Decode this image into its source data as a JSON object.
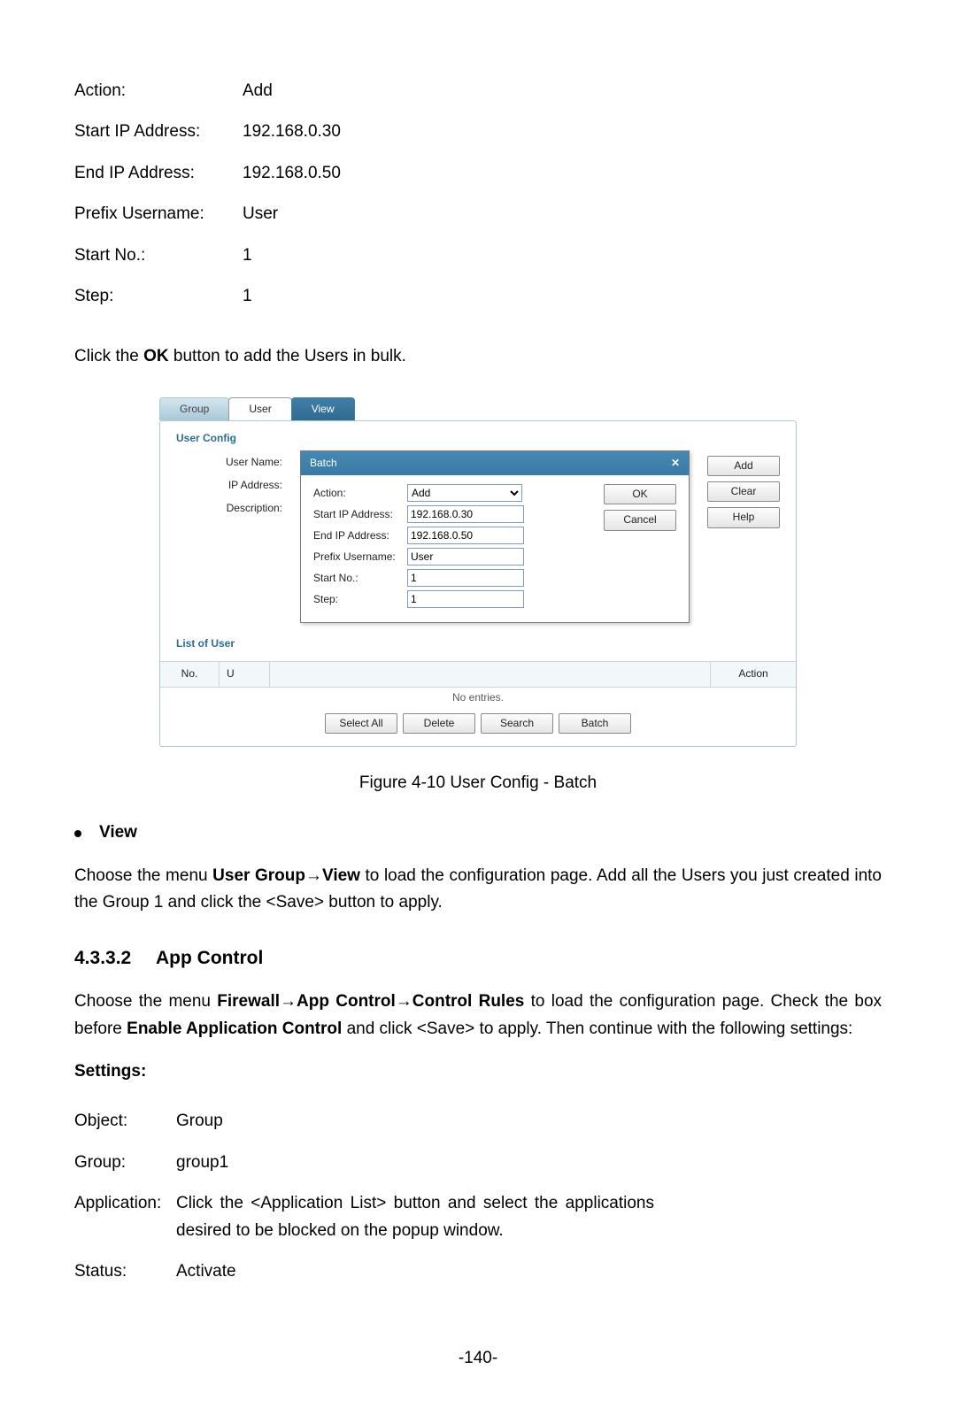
{
  "top_fields": {
    "action": {
      "label": "Action:",
      "value": "Add"
    },
    "start_ip": {
      "label": "Start IP Address:",
      "value": "192.168.0.30"
    },
    "end_ip": {
      "label": "End IP Address:",
      "value": "192.168.0.50"
    },
    "prefix_user": {
      "label": "Prefix Username:",
      "value": "User"
    },
    "start_no": {
      "label": "Start No.:",
      "value": "1"
    },
    "step": {
      "label": "Step:",
      "value": "1"
    }
  },
  "instruction": {
    "pre": "Click the ",
    "bold": "OK",
    "post": " button to add the Users in bulk."
  },
  "figure": {
    "tabs": {
      "group": "Group",
      "user": "User",
      "view": "View"
    },
    "section_user_config": "User Config",
    "left_labels": {
      "user_name": "User Name:",
      "ip_address": "IP Address:",
      "description": "Description:"
    },
    "popup": {
      "title": "Batch",
      "close": "✕",
      "fields": {
        "action": {
          "label": "Action:",
          "value": "Add"
        },
        "start_ip": {
          "label": "Start IP Address:",
          "value": "192.168.0.30"
        },
        "end_ip": {
          "label": "End IP Address:",
          "value": "192.168.0.50"
        },
        "prefix_user": {
          "label": "Prefix Username:",
          "value": "User"
        },
        "start_no": {
          "label": "Start No.:",
          "value": "1"
        },
        "step": {
          "label": "Step:",
          "value": "1"
        }
      },
      "buttons": {
        "ok": "OK",
        "cancel": "Cancel"
      }
    },
    "side_buttons": {
      "add": "Add",
      "clear": "Clear",
      "help": "Help"
    },
    "list": {
      "title": "List of User",
      "cols": {
        "no": "No.",
        "user": "U",
        "action": "Action"
      },
      "empty": "No entries."
    },
    "bottom_buttons": {
      "select_all": "Select All",
      "delete": "Delete",
      "search": "Search",
      "batch": "Batch"
    },
    "caption": "Figure 4-10 User Config - Batch"
  },
  "view_section": {
    "bullet": "View",
    "text_pre": "Choose the menu ",
    "text_bold": "User Group→View",
    "text_post": " to load the configuration page. Add all the Users you just created into the Group 1 and click the <Save> button to apply."
  },
  "app_control": {
    "heading_num": "4.3.3.2",
    "heading_title": "App Control",
    "p_pre": "Choose the menu ",
    "p_bold1": "Firewall→App Control→Control Rules",
    "p_mid": " to load the configuration page. Check the box before ",
    "p_bold2": "Enable Application Control",
    "p_post": " and click <Save> to apply. Then continue with the following settings:",
    "settings_label": "Settings:",
    "rows": {
      "object": {
        "label": "Object:",
        "value": "Group"
      },
      "group": {
        "label": "Group:",
        "value": "group1"
      },
      "application": {
        "label": "Application:",
        "value": "Click the <Application List> button and select the applications desired to be blocked on the popup window."
      },
      "status": {
        "label": "Status:",
        "value": "Activate"
      }
    }
  },
  "page_number": "-140-"
}
